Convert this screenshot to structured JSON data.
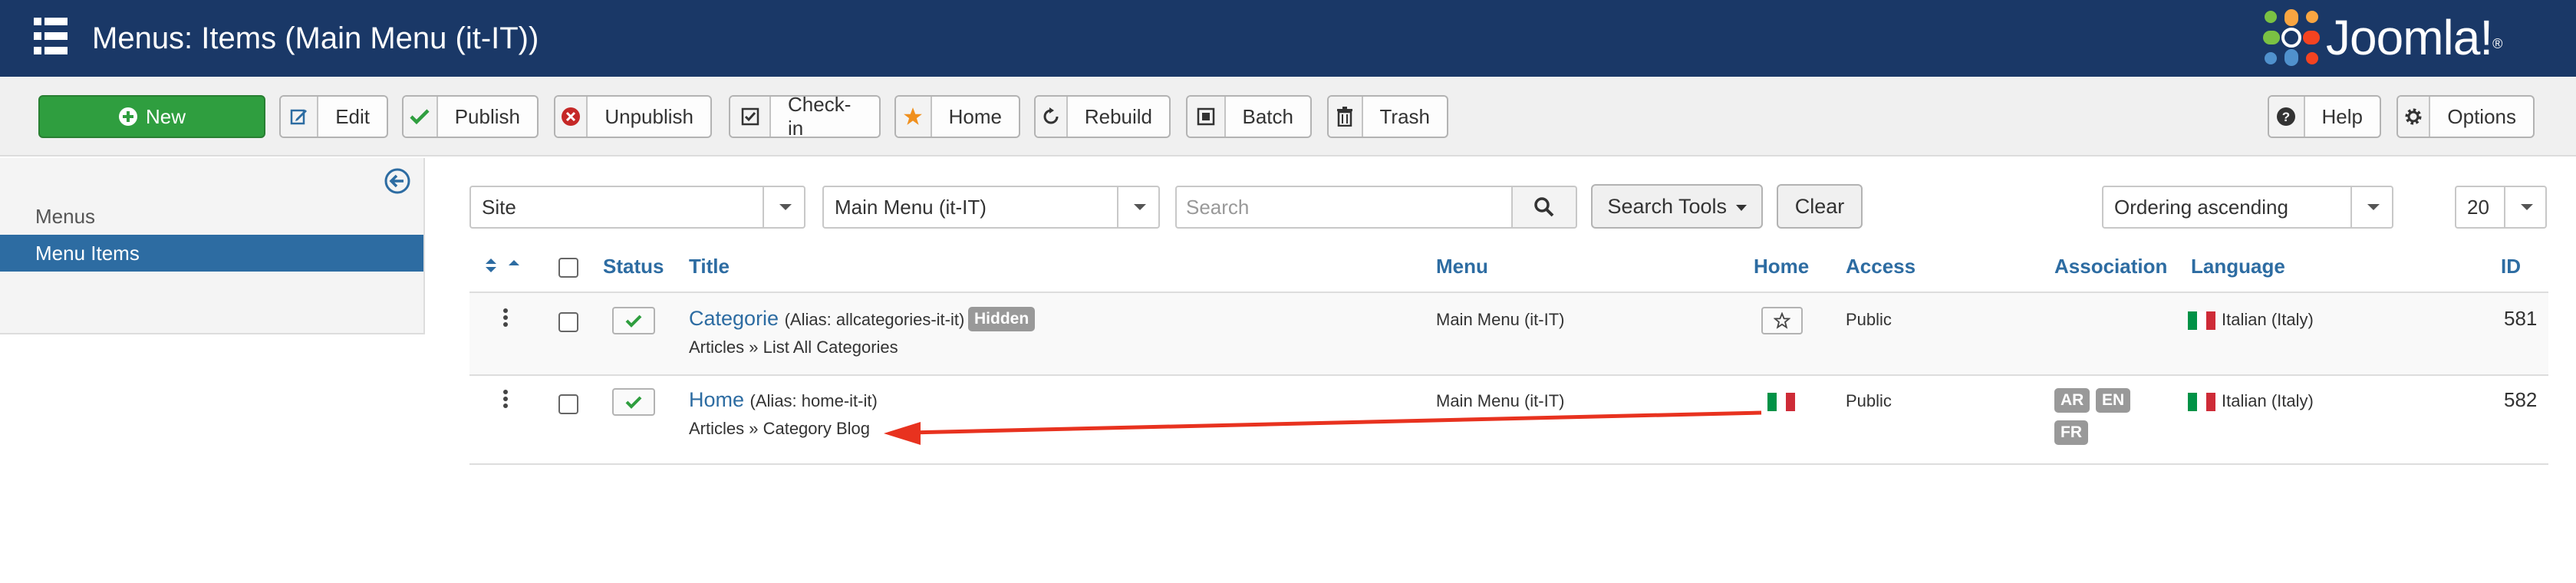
{
  "header": {
    "title": "Menus: Items (Main Menu (it-IT))",
    "brand": "Joomla!"
  },
  "toolbar": {
    "new": "New",
    "edit": "Edit",
    "publish": "Publish",
    "unpublish": "Unpublish",
    "checkin": "Check-in",
    "home": "Home",
    "rebuild": "Rebuild",
    "batch": "Batch",
    "trash": "Trash",
    "help": "Help",
    "options": "Options"
  },
  "sidebar": {
    "items": [
      {
        "label": "Menus",
        "active": false
      },
      {
        "label": "Menu Items",
        "active": true
      }
    ]
  },
  "filters": {
    "client": "Site",
    "menu": "Main Menu (it-IT)",
    "search_placeholder": "Search",
    "search_tools": "Search Tools",
    "clear": "Clear",
    "ordering": "Ordering ascending",
    "limit": "20"
  },
  "table": {
    "headers": {
      "status": "Status",
      "title": "Title",
      "menu": "Menu",
      "home": "Home",
      "access": "Access",
      "association": "Association",
      "language": "Language",
      "id": "ID"
    },
    "rows": [
      {
        "title": "Categorie",
        "alias": "(Alias: allcategories-it-it)",
        "badge": "Hidden",
        "type": "Articles » List All Categories",
        "menu": "Main Menu (it-IT)",
        "home": "star",
        "access": "Public",
        "associations": [],
        "language": "Italian (Italy)",
        "id": "581"
      },
      {
        "title": "Home",
        "alias": "(Alias: home-it-it)",
        "badge": "",
        "type": "Articles » Category Blog",
        "menu": "Main Menu (it-IT)",
        "home": "italy-flag",
        "access": "Public",
        "associations": [
          "AR",
          "EN",
          "FR"
        ],
        "language": "Italian (Italy)",
        "id": "582"
      }
    ]
  },
  "colors": {
    "header_bg": "#1a3867",
    "new_button": "#2f9e3f",
    "link": "#2d6ca2",
    "annotation_arrow": "#e8321f",
    "flag_green": "#009246",
    "flag_red": "#ce2b37"
  }
}
